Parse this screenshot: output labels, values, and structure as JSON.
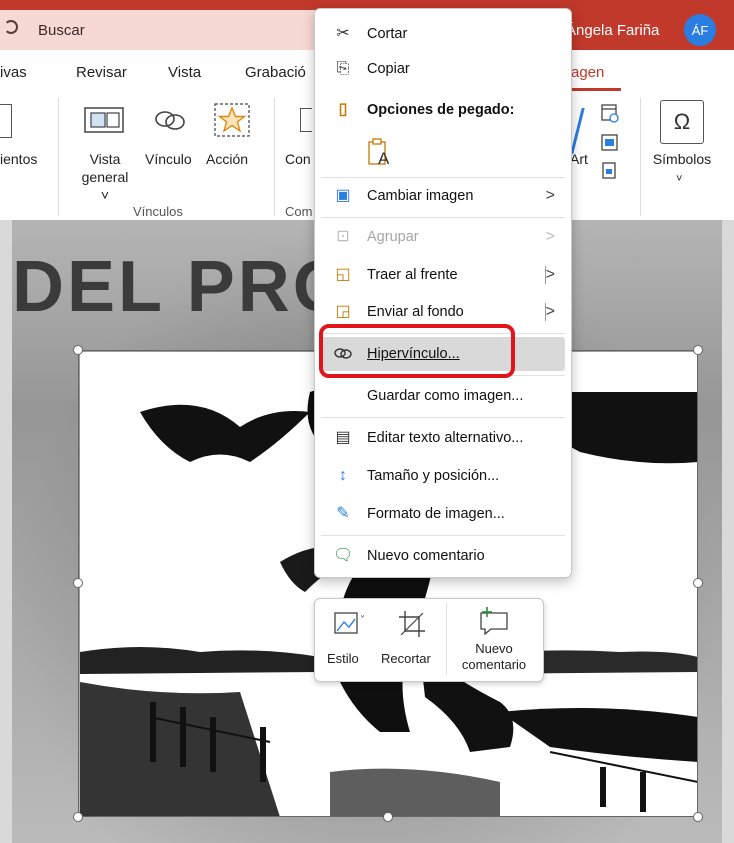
{
  "titlebar": {
    "search_label": "Buscar",
    "user_name": "Ángela Fariña",
    "avatar_initials": "ÁF",
    "accent_color": "#c0392b"
  },
  "ribbon_tabs": [
    "ivas",
    "Revisar",
    "Vista",
    "Grabació",
    "agen"
  ],
  "ribbon": {
    "btn_comentarios_partial": "ientos",
    "btn_vista_general_1": "Vista",
    "btn_vista_general_2": "general ˅",
    "btn_vinculo": "Vínculo",
    "btn_accion": "Acción",
    "btn_con_partial": "Con",
    "group_vinculos": "Vínculos",
    "group_com_partial": "Com",
    "btn_art_partial": "Art",
    "btn_simbolos": "Símbolos",
    "simbolos_glyph": "Ω"
  },
  "slide": {
    "title_text": "DEL PRO"
  },
  "context_menu": {
    "items": [
      {
        "label": "Cortar",
        "icon": "scissors-icon",
        "glyph": "✂"
      },
      {
        "label": "Copiar",
        "icon": "copy-icon",
        "glyph": "⎘"
      },
      {
        "label": "Opciones de pegado:",
        "icon": "paste-options-icon",
        "glyph": "📋"
      },
      {
        "label": "Cambiar imagen",
        "icon": "change-image-icon",
        "glyph": "▣",
        "submenu": true
      },
      {
        "label": "Agrupar",
        "icon": "group-icon",
        "glyph": "⊡",
        "submenu": true,
        "disabled": true
      },
      {
        "label": "Traer al frente",
        "icon": "bring-front-icon",
        "glyph": "◱",
        "submenu": true
      },
      {
        "label": "Enviar al fondo",
        "icon": "send-back-icon",
        "glyph": "◲",
        "submenu": true
      },
      {
        "label": "Hipervínculo...",
        "icon": "hyperlink-icon",
        "glyph": "🔗"
      },
      {
        "label": "Guardar como imagen...",
        "icon": "",
        "glyph": ""
      },
      {
        "label": "Editar texto alternativo...",
        "icon": "alt-text-icon",
        "glyph": "▤"
      },
      {
        "label": "Tamaño y posición...",
        "icon": "size-position-icon",
        "glyph": "↕"
      },
      {
        "label": "Formato de imagen...",
        "icon": "format-image-icon",
        "glyph": "✎"
      },
      {
        "label": "Nuevo comentario",
        "icon": "new-comment-icon",
        "glyph": "🗨"
      }
    ],
    "paste_icon_label": "A",
    "submenu_arrow": ">"
  },
  "mini_toolbar": {
    "estilo": "Estilo",
    "recortar": "Recortar",
    "nuevo_comentario_1": "Nuevo",
    "nuevo_comentario_2": "comentario"
  },
  "colors": {
    "highlight": "#e0151b",
    "avatar": "#2a7de1"
  }
}
